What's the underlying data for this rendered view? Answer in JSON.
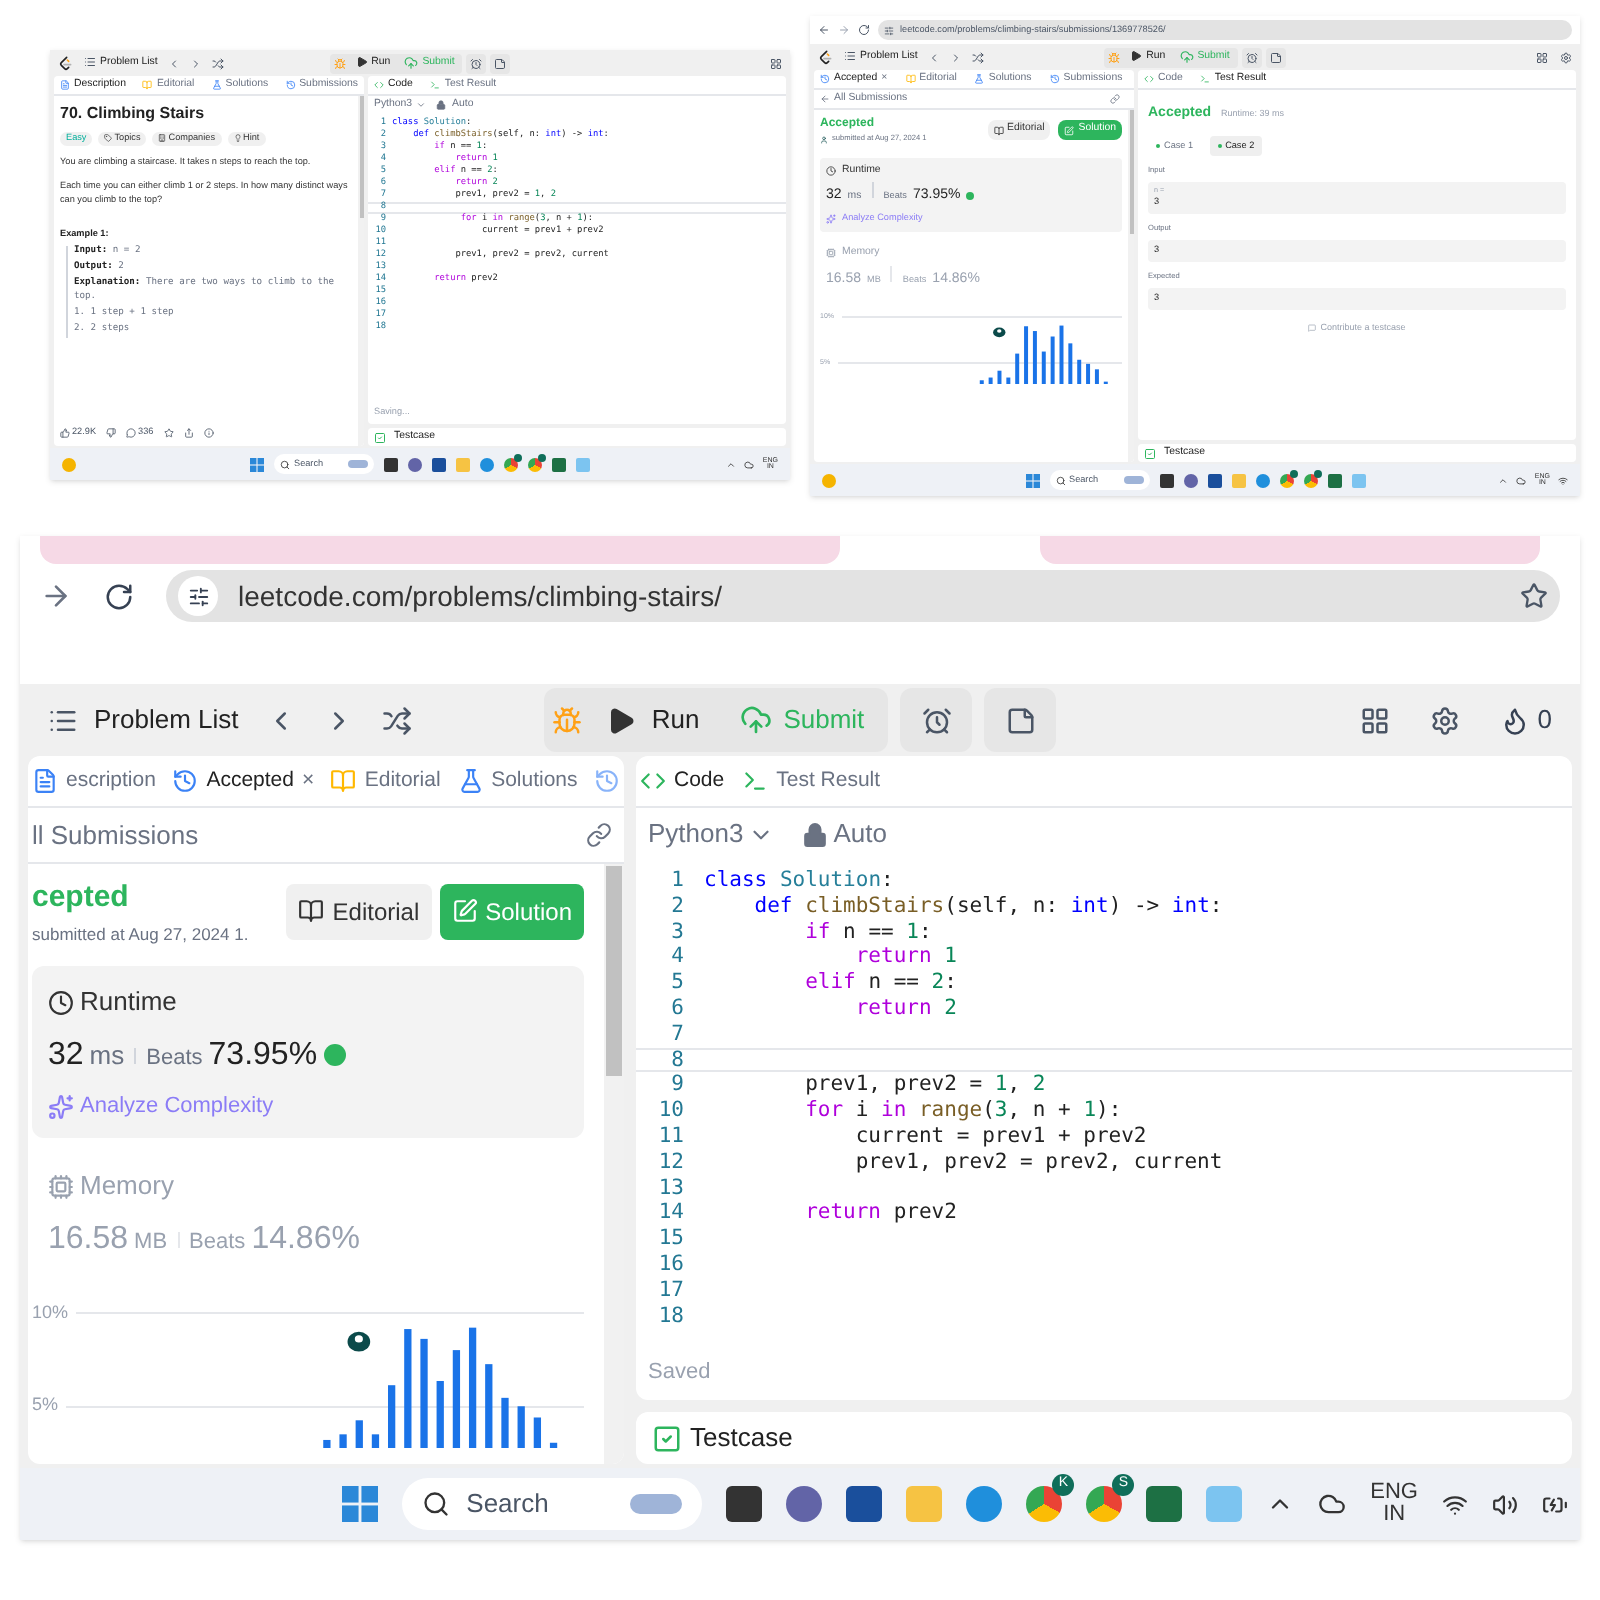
{
  "top_left": {
    "header": {
      "problem_list": "Problem List",
      "run": "Run",
      "submit": "Submit"
    },
    "left": {
      "tabs": [
        {
          "kind": "description",
          "label": "Description",
          "selected": true
        },
        {
          "kind": "editorial",
          "label": "Editorial",
          "selected": false
        },
        {
          "kind": "solutions",
          "label": "Solutions",
          "selected": false
        },
        {
          "kind": "submissions",
          "label": "Submissions",
          "selected": false
        }
      ],
      "content": {
        "kind": "description",
        "title": "70. Climbing Stairs",
        "tags": [
          {
            "kind": "easy",
            "label": "Easy"
          },
          {
            "kind": "topics",
            "label": "Topics"
          },
          {
            "kind": "companies",
            "label": "Companies"
          },
          {
            "kind": "hint",
            "label": "Hint"
          }
        ],
        "paragraphs": [
          "You are climbing a staircase. It takes n steps to reach the top.",
          "Each time you can either climb 1 or 2 steps. In how many distinct ways can you climb to the top?"
        ],
        "example": {
          "heading": "Example 1:",
          "lines": [
            {
              "label": "Input:",
              "value": "n = 2"
            },
            {
              "label": "Output:",
              "value": "2"
            },
            {
              "label": "Explanation:",
              "value": "There are two ways to climb to the top."
            },
            {
              "value": "1. 1 step + 1 step"
            },
            {
              "value": "2. 2 steps"
            }
          ]
        },
        "footer": {
          "likes": "22.9K",
          "comments": "336"
        }
      }
    },
    "right": {
      "tabs": [
        {
          "kind": "code",
          "label": "Code",
          "selected": true
        },
        {
          "kind": "result",
          "label": "Test Result",
          "selected": false
        }
      ],
      "content": {
        "kind": "code",
        "language": "Python3",
        "mode": "Auto",
        "status": "Saving...",
        "lines": [
          {
            "n": "1",
            "active": false,
            "s": [
              {
                "text": "class ",
                "kind": "b"
              },
              {
                "text": "Solution",
                "kind": "c"
              },
              {
                "text": ":",
                "kind": "p"
              }
            ]
          },
          {
            "n": "2",
            "active": false,
            "s": [
              {
                "text": "    def ",
                "kind": "b"
              },
              {
                "text": "climbStairs",
                "kind": "f"
              },
              {
                "text": "(self, n: ",
                "kind": "p"
              },
              {
                "text": "int",
                "kind": "b"
              },
              {
                "text": ") -> ",
                "kind": "p"
              },
              {
                "text": "int",
                "kind": "b"
              },
              {
                "text": ":",
                "kind": "p"
              }
            ]
          },
          {
            "n": "3",
            "active": false,
            "s": [
              {
                "text": "        if ",
                "kind": "k"
              },
              {
                "text": "n == ",
                "kind": "p"
              },
              {
                "text": "1",
                "kind": "n"
              },
              {
                "text": ":",
                "kind": "p"
              }
            ]
          },
          {
            "n": "4",
            "active": false,
            "s": [
              {
                "text": "            return ",
                "kind": "k"
              },
              {
                "text": "1",
                "kind": "n"
              }
            ]
          },
          {
            "n": "5",
            "active": false,
            "s": [
              {
                "text": "        elif ",
                "kind": "k"
              },
              {
                "text": "n == ",
                "kind": "p"
              },
              {
                "text": "2",
                "kind": "n"
              },
              {
                "text": ":",
                "kind": "p"
              }
            ]
          },
          {
            "n": "6",
            "active": false,
            "s": [
              {
                "text": "            return ",
                "kind": "k"
              },
              {
                "text": "2",
                "kind": "n"
              }
            ]
          },
          {
            "n": "7",
            "active": false,
            "s": [
              {
                "text": "            prev1, prev2 = ",
                "kind": "p"
              },
              {
                "text": "1",
                "kind": "n"
              },
              {
                "text": ", ",
                "kind": "p"
              },
              {
                "text": "2",
                "kind": "n"
              }
            ]
          },
          {
            "n": "8",
            "active": true
          },
          {
            "n": "9",
            "active": false,
            "s": [
              {
                "text": "             for ",
                "kind": "k"
              },
              {
                "text": "i ",
                "kind": "p"
              },
              {
                "text": "in ",
                "kind": "k"
              },
              {
                "text": "range",
                "kind": "f"
              },
              {
                "text": "(",
                "kind": "p"
              },
              {
                "text": "3",
                "kind": "n"
              },
              {
                "text": ", n + ",
                "kind": "p"
              },
              {
                "text": "1",
                "kind": "n"
              },
              {
                "text": "):",
                "kind": "p"
              }
            ]
          },
          {
            "n": "10",
            "active": false,
            "s": [
              {
                "text": "                 current = prev1 + prev2",
                "kind": "p"
              }
            ]
          },
          {
            "n": "11",
            "active": false
          },
          {
            "n": "12",
            "active": false,
            "s": [
              {
                "text": "            prev1, prev2 = prev2, current",
                "kind": "p"
              }
            ]
          },
          {
            "n": "13",
            "active": false
          },
          {
            "n": "14",
            "active": false,
            "s": [
              {
                "text": "        return ",
                "kind": "k"
              },
              {
                "text": "prev2",
                "kind": "p"
              }
            ]
          },
          {
            "n": "15",
            "active": false
          },
          {
            "n": "16",
            "active": false
          },
          {
            "n": "17",
            "active": false
          },
          {
            "n": "18",
            "active": false
          }
        ]
      }
    },
    "testcase": "Testcase",
    "taskbar": {
      "search": "Search",
      "lang": "ENG",
      "region": "IN"
    }
  },
  "top_right": {
    "browser": {
      "address": "leetcode.com/problems/climbing-stairs/submissions/1369778526/"
    },
    "header": {
      "problem_list": "Problem List",
      "run": "Run",
      "submit": "Submit"
    },
    "left": {
      "tabs": [
        {
          "kind": "history",
          "label": "Accepted",
          "selected": true,
          "close": "×"
        },
        {
          "kind": "editorial",
          "label": "Editorial",
          "selected": false
        },
        {
          "kind": "solutions",
          "label": "Solutions",
          "selected": false
        },
        {
          "kind": "submissions",
          "label": "Submissions",
          "selected": false
        }
      ],
      "content": {
        "kind": "submission",
        "all_submissions": "All Submissions",
        "status": "Accepted",
        "submitted": "submitted at Aug 27, 2024 1",
        "editorial": "Editorial",
        "solution": "Solution",
        "runtime": {
          "title": "Runtime",
          "value": "32",
          "unit": "ms",
          "beats_label": "Beats",
          "beats": "73.95%"
        },
        "analyze": "Analyze Complexity",
        "memory": {
          "title": "Memory",
          "value": "16.58",
          "unit": "MB",
          "beats_label": "Beats",
          "beats": "14.86%"
        },
        "chart_ticks": [
          "10%",
          "5%"
        ]
      }
    },
    "right": {
      "tabs": [
        {
          "kind": "code",
          "label": "Code",
          "selected": false
        },
        {
          "kind": "result",
          "label": "Test Result",
          "selected": true
        }
      ],
      "content": {
        "kind": "result",
        "status": "Accepted",
        "runtime": "Runtime: 39 ms",
        "cases": [
          {
            "label": "Case 1",
            "selected": false
          },
          {
            "label": "Case 2",
            "selected": true
          }
        ],
        "fields": [
          {
            "label": "Input",
            "var": "n =",
            "value": "3"
          },
          {
            "label": "Output",
            "value": "3"
          },
          {
            "label": "Expected",
            "value": "3"
          }
        ],
        "contribute": "Contribute a testcase"
      }
    },
    "testcase": "Testcase",
    "taskbar": {
      "search": "Search",
      "lang": "ENG",
      "region": "IN"
    }
  },
  "bottom": {
    "browser": {
      "address": "leetcode.com/problems/climbing-stairs/"
    },
    "header": {
      "problem_list": "Problem List",
      "run": "Run",
      "submit": "Submit",
      "counter": "0"
    },
    "left": {
      "tabs": [
        {
          "kind": "description",
          "label": "escription",
          "selected": false
        },
        {
          "kind": "history",
          "label": "Accepted",
          "selected": true,
          "close": "×"
        },
        {
          "kind": "editorial",
          "label": "Editorial",
          "selected": false
        },
        {
          "kind": "solutions",
          "label": "Solutions",
          "selected": false
        },
        {
          "kind": "submissions",
          "selected": false
        }
      ],
      "content": {
        "kind": "submission",
        "all_submissions": "ll Submissions",
        "status": "cepted",
        "submitted": "submitted at Aug 27, 2024 1.",
        "editorial": "Editorial",
        "solution": "Solution",
        "runtime": {
          "title": "Runtime",
          "value": "32",
          "unit": "ms",
          "beats_label": "Beats",
          "beats": "73.95%"
        },
        "analyze": "Analyze Complexity",
        "memory": {
          "title": "Memory",
          "value": "16.58",
          "unit": "MB",
          "beats_label": "Beats",
          "beats": "14.86%"
        },
        "chart_ticks": [
          "10%",
          "5%"
        ]
      }
    },
    "right": {
      "tabs": [
        {
          "kind": "code",
          "label": "Code",
          "selected": true
        },
        {
          "kind": "result",
          "label": "Test Result",
          "selected": false
        }
      ],
      "content": {
        "kind": "code",
        "language": "Python3",
        "mode": "Auto",
        "status": "Saved",
        "lines": [
          {
            "n": "1",
            "active": false,
            "s": [
              {
                "text": "class ",
                "kind": "b"
              },
              {
                "text": "Solution",
                "kind": "c"
              },
              {
                "text": ":",
                "kind": "p"
              }
            ]
          },
          {
            "n": "2",
            "active": false,
            "s": [
              {
                "text": "    def ",
                "kind": "b"
              },
              {
                "text": "climbStairs",
                "kind": "f"
              },
              {
                "text": "(self, n: ",
                "kind": "p"
              },
              {
                "text": "int",
                "kind": "b"
              },
              {
                "text": ") -> ",
                "kind": "p"
              },
              {
                "text": "int",
                "kind": "b"
              },
              {
                "text": ":",
                "kind": "p"
              }
            ]
          },
          {
            "n": "3",
            "active": false,
            "s": [
              {
                "text": "        if ",
                "kind": "k"
              },
              {
                "text": "n == ",
                "kind": "p"
              },
              {
                "text": "1",
                "kind": "n"
              },
              {
                "text": ":",
                "kind": "p"
              }
            ]
          },
          {
            "n": "4",
            "active": false,
            "s": [
              {
                "text": "            return ",
                "kind": "k"
              },
              {
                "text": "1",
                "kind": "n"
              }
            ]
          },
          {
            "n": "5",
            "active": false,
            "s": [
              {
                "text": "        elif ",
                "kind": "k"
              },
              {
                "text": "n == ",
                "kind": "p"
              },
              {
                "text": "2",
                "kind": "n"
              },
              {
                "text": ":",
                "kind": "p"
              }
            ]
          },
          {
            "n": "6",
            "active": false,
            "s": [
              {
                "text": "            return ",
                "kind": "k"
              },
              {
                "text": "2",
                "kind": "n"
              }
            ]
          },
          {
            "n": "7",
            "active": false
          },
          {
            "n": "8",
            "active": true
          },
          {
            "n": "9",
            "active": false,
            "s": [
              {
                "text": "        prev1, prev2 = ",
                "kind": "p"
              },
              {
                "text": "1",
                "kind": "n"
              },
              {
                "text": ", ",
                "kind": "p"
              },
              {
                "text": "2",
                "kind": "n"
              }
            ]
          },
          {
            "n": "10",
            "active": false,
            "s": [
              {
                "text": "        for ",
                "kind": "k"
              },
              {
                "text": "i ",
                "kind": "p"
              },
              {
                "text": "in ",
                "kind": "k"
              },
              {
                "text": "range",
                "kind": "f"
              },
              {
                "text": "(",
                "kind": "p"
              },
              {
                "text": "3",
                "kind": "n"
              },
              {
                "text": ", n + ",
                "kind": "p"
              },
              {
                "text": "1",
                "kind": "n"
              },
              {
                "text": "):",
                "kind": "p"
              }
            ]
          },
          {
            "n": "11",
            "active": false,
            "s": [
              {
                "text": "            current = prev1 + prev2",
                "kind": "p"
              }
            ]
          },
          {
            "n": "12",
            "active": false,
            "s": [
              {
                "text": "            prev1, prev2 = prev2, current",
                "kind": "p"
              }
            ]
          },
          {
            "n": "13",
            "active": false
          },
          {
            "n": "14",
            "active": false,
            "s": [
              {
                "text": "        return ",
                "kind": "k"
              },
              {
                "text": "prev2",
                "kind": "p"
              }
            ]
          },
          {
            "n": "15",
            "active": false
          },
          {
            "n": "16",
            "active": false
          },
          {
            "n": "17",
            "active": false
          },
          {
            "n": "18",
            "active": false
          }
        ]
      }
    },
    "testcase": "Testcase",
    "taskbar": {
      "search": "Search",
      "lang": "ENG",
      "region": "IN",
      "badges": [
        "K",
        "S"
      ]
    }
  }
}
